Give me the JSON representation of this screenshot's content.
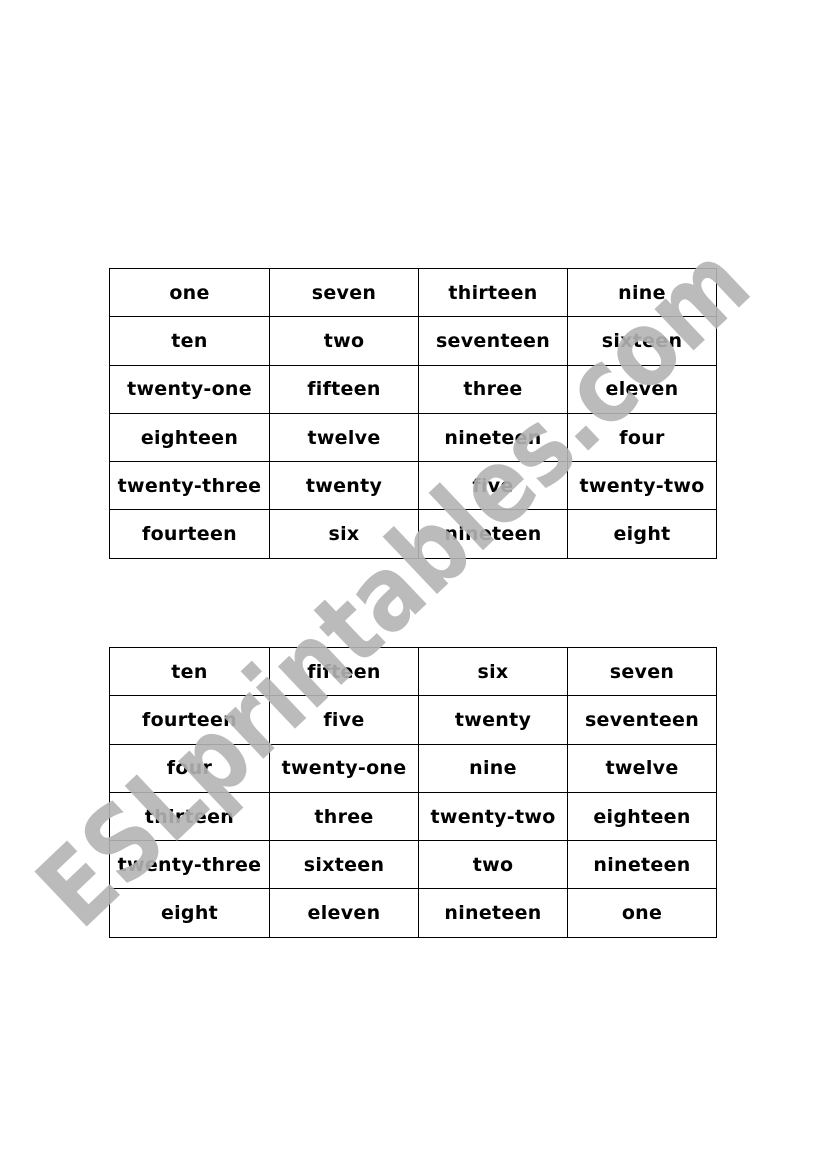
{
  "tables": [
    {
      "rows": [
        [
          "one",
          "seven",
          "thirteen",
          "nine"
        ],
        [
          "ten",
          "two",
          "seventeen",
          "sixteen"
        ],
        [
          "twenty-one",
          "fifteen",
          "three",
          "eleven"
        ],
        [
          "eighteen",
          "twelve",
          "nineteen",
          "four"
        ],
        [
          "twenty-three",
          "twenty",
          "five",
          "twenty-two"
        ],
        [
          "fourteen",
          "six",
          "nineteen",
          "eight"
        ]
      ]
    },
    {
      "rows": [
        [
          "ten",
          "fifteen",
          "six",
          "seven"
        ],
        [
          "fourteen",
          "five",
          "twenty",
          "seventeen"
        ],
        [
          "four",
          "twenty-one",
          "nine",
          "twelve"
        ],
        [
          "thirteen",
          "three",
          "twenty-two",
          "eighteen"
        ],
        [
          "twenty-three",
          "sixteen",
          "two",
          "nineteen"
        ],
        [
          "eight",
          "eleven",
          "nineteen",
          "one"
        ]
      ]
    }
  ],
  "watermark": {
    "text": "ESLprintables.com",
    "color": "#b4b4b4"
  }
}
